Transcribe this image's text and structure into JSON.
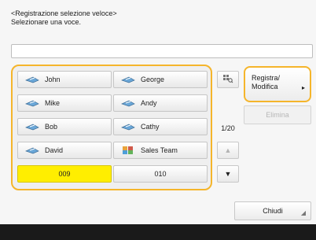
{
  "title_lines": [
    "<Registrazione selezione veloce>",
    "Selezionare una voce."
  ],
  "entries": [
    {
      "label": "John",
      "icon": "fax-icon"
    },
    {
      "label": "George",
      "icon": "fax-icon"
    },
    {
      "label": "Mike",
      "icon": "fax-icon"
    },
    {
      "label": "Andy",
      "icon": "fax-icon"
    },
    {
      "label": "Bob",
      "icon": "fax-icon"
    },
    {
      "label": "Cathy",
      "icon": "fax-icon"
    },
    {
      "label": "David",
      "icon": "fax-icon"
    },
    {
      "label": "Sales Team",
      "icon": "group-icon"
    },
    {
      "label": "009",
      "icon": ""
    },
    {
      "label": "010",
      "icon": ""
    }
  ],
  "page_counter": "1/20",
  "register_label_line1": "Registra/",
  "register_label_line2": "Modifica",
  "delete_label": "Elimina",
  "close_label": "Chiudi",
  "colors": {
    "accent": "#f5b52b",
    "selected": "#ffee00"
  }
}
